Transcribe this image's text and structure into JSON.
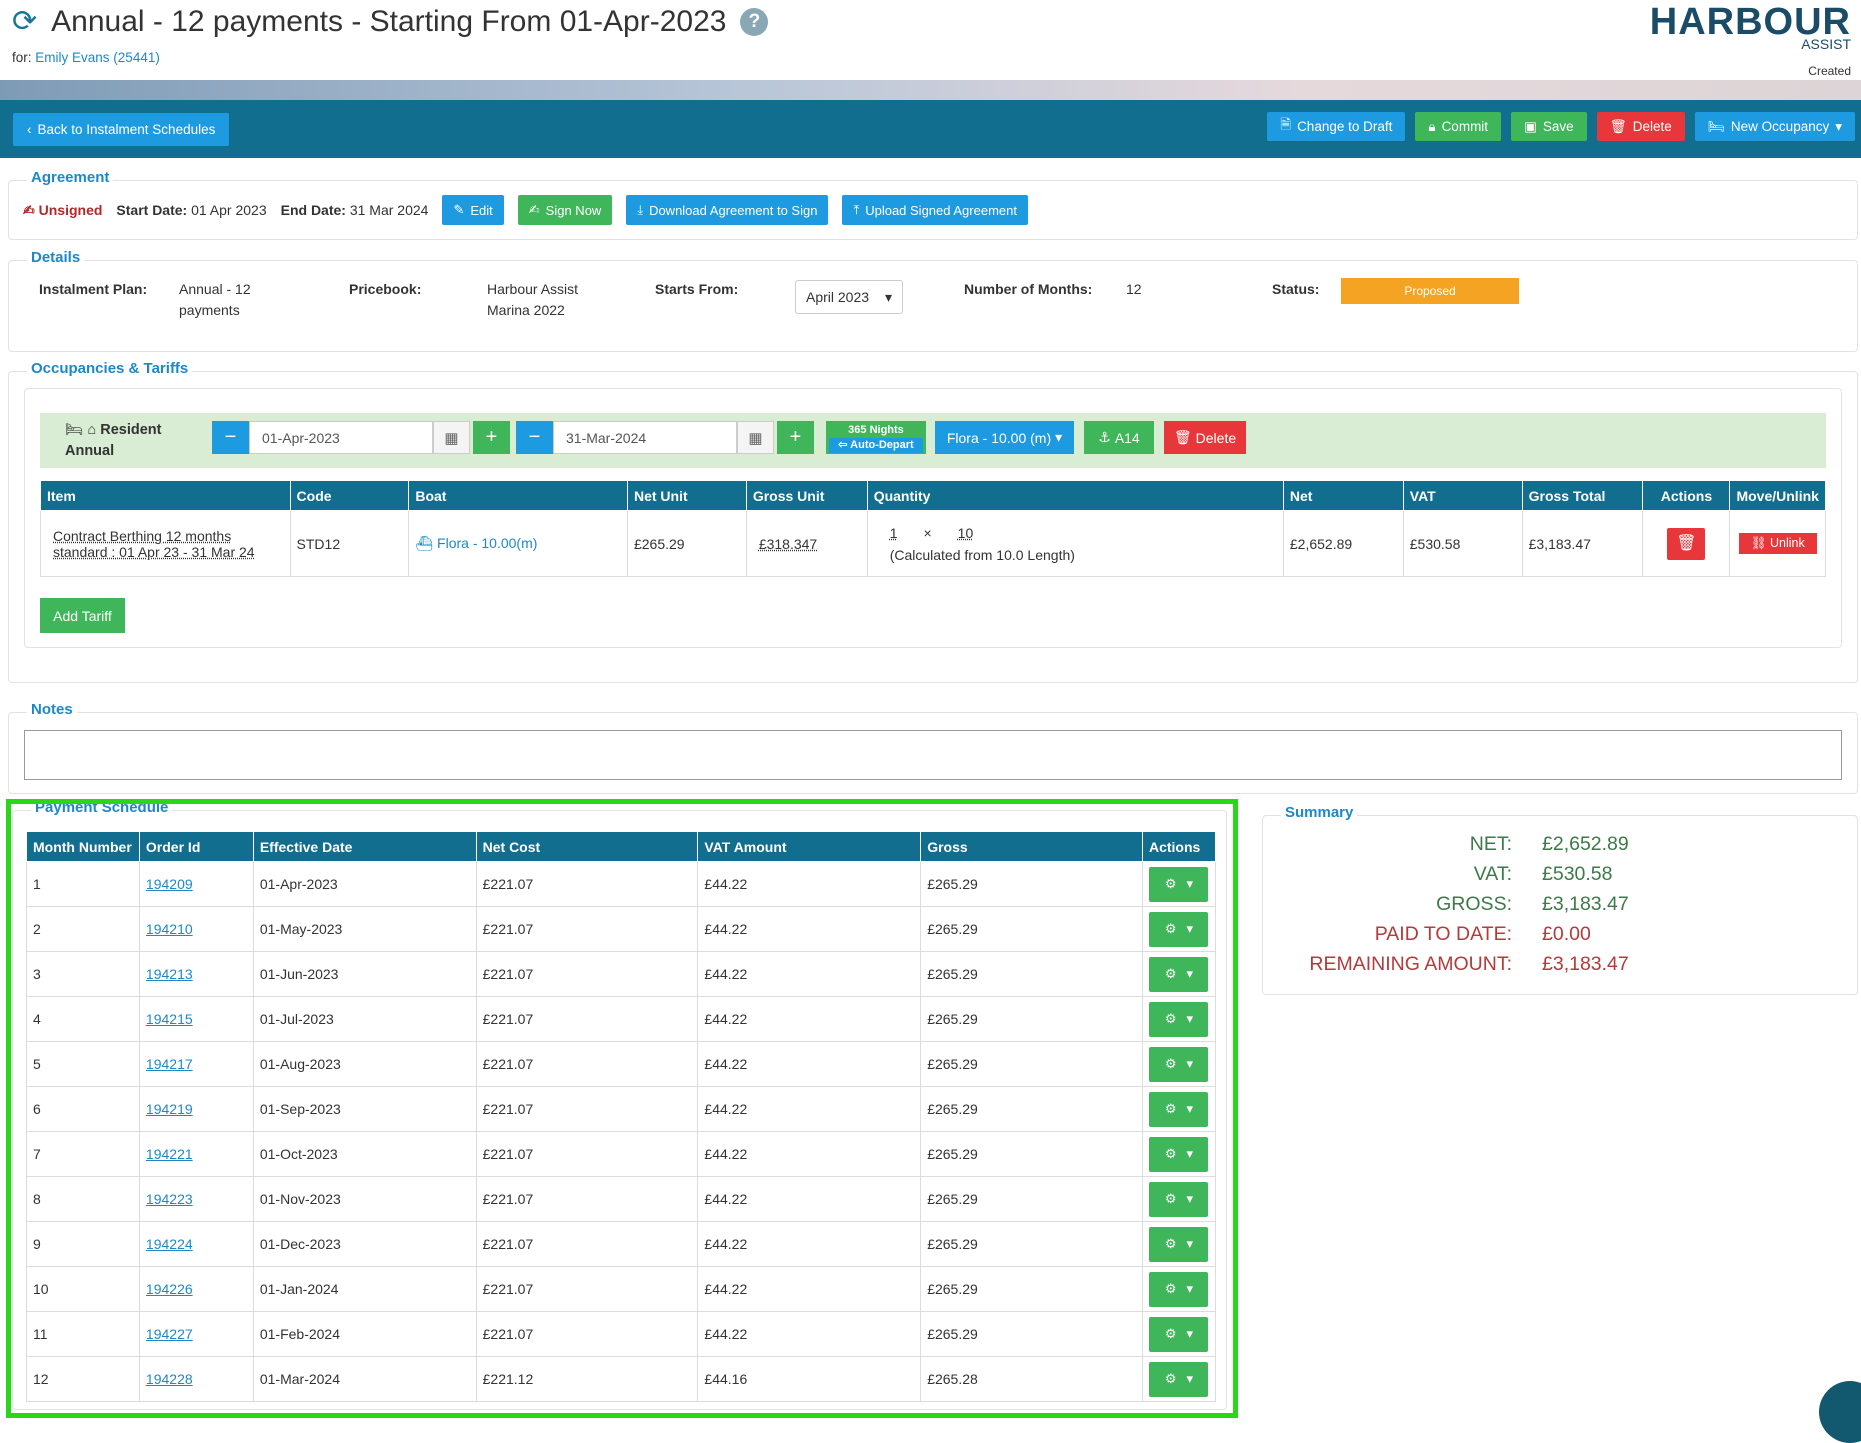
{
  "header": {
    "title": "Annual - 12 payments - Starting From 01-Apr-2023",
    "help_glyph": "?",
    "for_label": "for:",
    "for_value": "Emily Evans (25441)",
    "logo_main": "HARBOUR",
    "logo_sub": "ASSIST",
    "logo_created": "Created"
  },
  "toolbar": {
    "back": "Back to Instalment Schedules",
    "change_to_draft": "Change to Draft",
    "commit": "Commit",
    "save": "Save",
    "delete": "Delete",
    "new_occupancy": "New Occupancy"
  },
  "agreement": {
    "legend": "Agreement",
    "status": "Unsigned",
    "start_label": "Start Date:",
    "start_value": "01 Apr 2023",
    "end_label": "End Date:",
    "end_value": "31 Mar 2024",
    "edit": "Edit",
    "sign_now": "Sign Now",
    "download": "Download Agreement to Sign",
    "upload": "Upload Signed Agreement"
  },
  "details": {
    "legend": "Details",
    "plan_label": "Instalment Plan:",
    "plan_line1": "Annual - 12",
    "plan_line2": "payments",
    "pricebook_label": "Pricebook:",
    "pricebook_line1": "Harbour Assist",
    "pricebook_line2": "Marina 2022",
    "starts_label": "Starts From:",
    "starts_value": "April 2023",
    "months_label": "Number of Months:",
    "months_value": "12",
    "status_label": "Status:",
    "status_value": "Proposed"
  },
  "occupancies": {
    "legend": "Occupancies & Tariffs",
    "resident_line1": "Resident",
    "resident_line2": "Annual",
    "start_date": "01-Apr-2023",
    "end_date": "31-Mar-2024",
    "nights": "365 Nights",
    "auto_depart": "Auto-Depart",
    "boat_btn": "Flora - 10.00 (m)",
    "berth_btn": "A14",
    "delete_btn": "Delete",
    "columns": [
      "Item",
      "Code",
      "Boat",
      "Net Unit",
      "Gross Unit",
      "Quantity",
      "Net",
      "VAT",
      "Gross Total",
      "Actions",
      "Move/Unlink"
    ],
    "row": {
      "item_line1": "Contract Berthing 12 months",
      "item_line2": "standard : 01 Apr 23 - 31 Mar 24",
      "code": "STD12",
      "boat": "Flora - 10.00(m)",
      "net_unit": "£265.29",
      "gross_unit": "£318.347",
      "qty_a": "1",
      "qty_x": "×",
      "qty_b": "10",
      "qty_note": "(Calculated from 10.0 Length)",
      "net": "£2,652.89",
      "vat": "£530.58",
      "gross_total": "£3,183.47",
      "unlink": "Unlink"
    },
    "add_tariff": "Add Tariff"
  },
  "notes": {
    "legend": "Notes",
    "value": ""
  },
  "payment_schedule": {
    "legend": "Payment Schedule",
    "columns": [
      "Month Number",
      "Order Id",
      "Effective Date",
      "Net Cost",
      "VAT Amount",
      "Gross",
      "Actions"
    ],
    "rows": [
      {
        "month": "1",
        "order": "194209",
        "date": "01-Apr-2023",
        "net": "£221.07",
        "vat": "£44.22",
        "gross": "£265.29"
      },
      {
        "month": "2",
        "order": "194210",
        "date": "01-May-2023",
        "net": "£221.07",
        "vat": "£44.22",
        "gross": "£265.29"
      },
      {
        "month": "3",
        "order": "194213",
        "date": "01-Jun-2023",
        "net": "£221.07",
        "vat": "£44.22",
        "gross": "£265.29"
      },
      {
        "month": "4",
        "order": "194215",
        "date": "01-Jul-2023",
        "net": "£221.07",
        "vat": "£44.22",
        "gross": "£265.29"
      },
      {
        "month": "5",
        "order": "194217",
        "date": "01-Aug-2023",
        "net": "£221.07",
        "vat": "£44.22",
        "gross": "£265.29"
      },
      {
        "month": "6",
        "order": "194219",
        "date": "01-Sep-2023",
        "net": "£221.07",
        "vat": "£44.22",
        "gross": "£265.29"
      },
      {
        "month": "7",
        "order": "194221",
        "date": "01-Oct-2023",
        "net": "£221.07",
        "vat": "£44.22",
        "gross": "£265.29"
      },
      {
        "month": "8",
        "order": "194223",
        "date": "01-Nov-2023",
        "net": "£221.07",
        "vat": "£44.22",
        "gross": "£265.29"
      },
      {
        "month": "9",
        "order": "194224",
        "date": "01-Dec-2023",
        "net": "£221.07",
        "vat": "£44.22",
        "gross": "£265.29"
      },
      {
        "month": "10",
        "order": "194226",
        "date": "01-Jan-2024",
        "net": "£221.07",
        "vat": "£44.22",
        "gross": "£265.29"
      },
      {
        "month": "11",
        "order": "194227",
        "date": "01-Feb-2024",
        "net": "£221.07",
        "vat": "£44.22",
        "gross": "£265.29"
      },
      {
        "month": "12",
        "order": "194228",
        "date": "01-Mar-2024",
        "net": "£221.12",
        "vat": "£44.16",
        "gross": "£265.28"
      }
    ]
  },
  "summary": {
    "legend": "Summary",
    "net_label": "NET:",
    "net_value": "£2,652.89",
    "vat_label": "VAT:",
    "vat_value": "£530.58",
    "gross_label": "GROSS:",
    "gross_value": "£3,183.47",
    "paid_label": "PAID TO DATE:",
    "paid_value": "£0.00",
    "remaining_label": "REMAINING AMOUNT:",
    "remaining_value": "£3,183.47"
  },
  "colors": {
    "toolbar": "#126e8f",
    "table_header": "#126e8f",
    "blue_button": "#1e9be0",
    "green_button": "#3fb65a",
    "red_button": "#e8373a",
    "proposed": "#f5a323",
    "highlight_frame": "#2bd61a"
  }
}
